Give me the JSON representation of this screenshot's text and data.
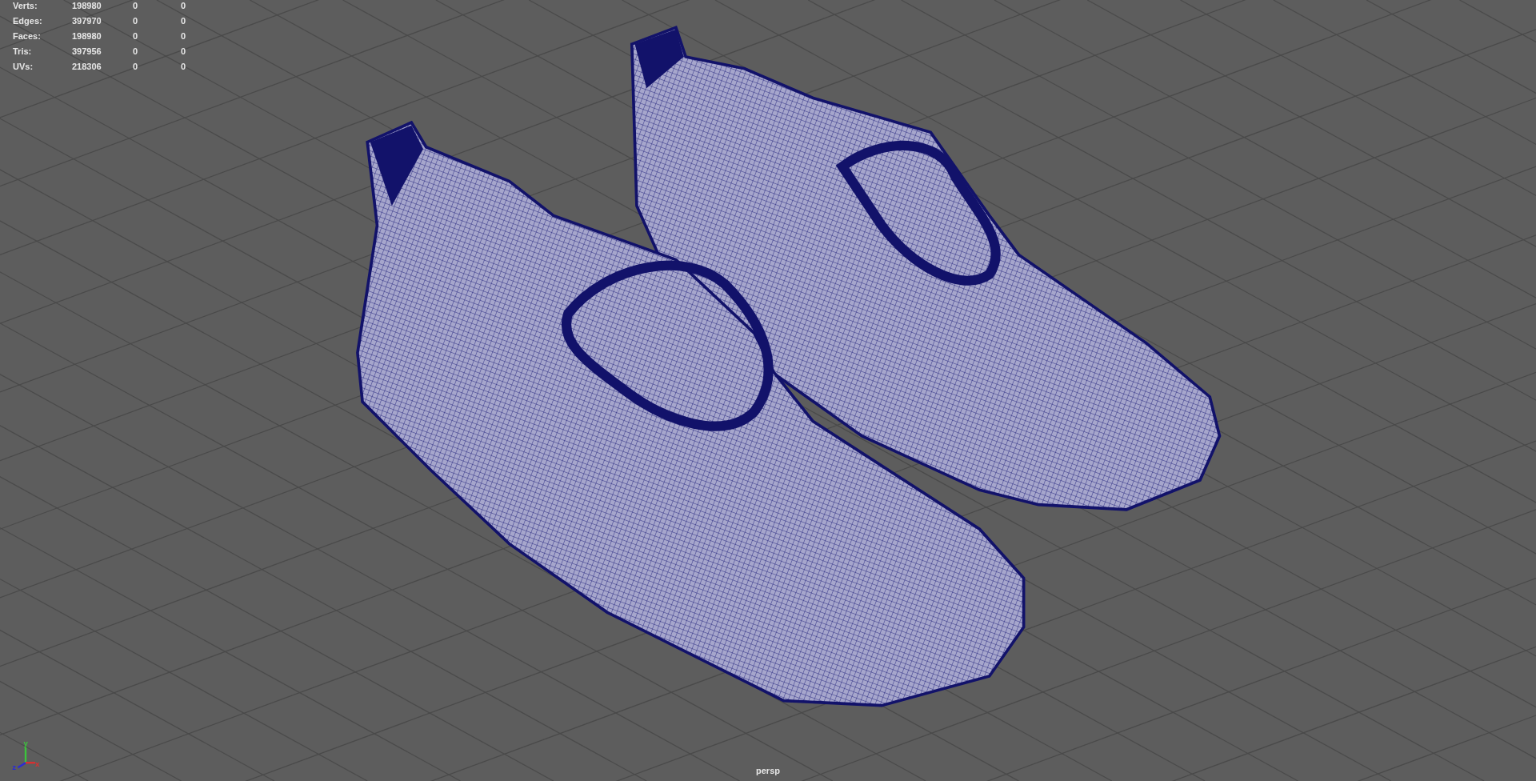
{
  "hud": {
    "rows": [
      {
        "label": "Verts:",
        "values": [
          "198980",
          "0",
          "0"
        ]
      },
      {
        "label": "Edges:",
        "values": [
          "397970",
          "0",
          "0"
        ]
      },
      {
        "label": "Faces:",
        "values": [
          "198980",
          "0",
          "0"
        ]
      },
      {
        "label": "Tris:",
        "values": [
          "397956",
          "0",
          "0"
        ]
      },
      {
        "label": "UVs:",
        "values": [
          "218306",
          "0",
          "0"
        ]
      }
    ]
  },
  "axes": [
    {
      "kind": "y",
      "label": "y",
      "color": "#3cc43c"
    },
    {
      "kind": "z",
      "label": "z",
      "color": "#2b2bd8"
    },
    {
      "kind": "x",
      "label": "x",
      "color": "#d83030"
    }
  ],
  "camera": "persp"
}
